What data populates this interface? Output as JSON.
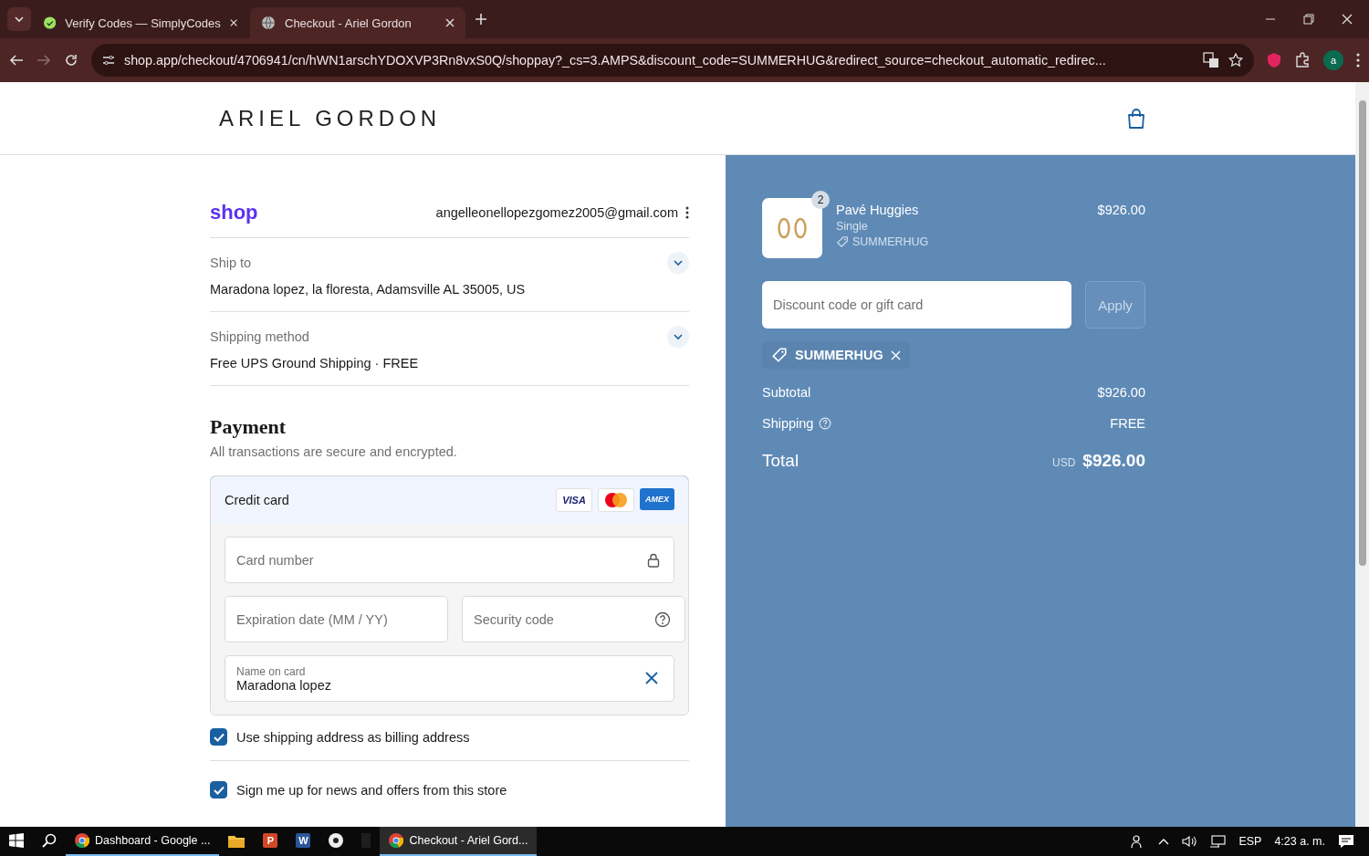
{
  "browser": {
    "tabs": [
      {
        "title": "Verify Codes — SimplyCodes",
        "selected": false
      },
      {
        "title": "Checkout - Ariel Gordon",
        "selected": true
      }
    ],
    "url": "shop.app/checkout/4706941/cn/hWN1arschYDOXVP3Rn8vxS0Q/shoppay?_cs=3.AMPS&discount_code=SUMMERHUG&redirect_source=checkout_automatic_redirec...",
    "profile": "a"
  },
  "header": {
    "logo": "ARIEL GORDON"
  },
  "account": {
    "shop_logo": "shop",
    "email": "angelleonellopezgomez2005@gmail.com"
  },
  "sections": [
    {
      "label": "Ship to",
      "value": "Maradona lopez, la floresta, Adamsville AL 35005, US"
    },
    {
      "label": "Shipping method",
      "value": "Free UPS Ground Shipping · FREE"
    }
  ],
  "payment": {
    "title": "Payment",
    "subtitle": "All transactions are secure and encrypted.",
    "method": "Credit card",
    "brands": [
      "VISA",
      "AMEX"
    ],
    "card_number": {
      "placeholder": "Card number"
    },
    "expiration": {
      "placeholder": "Expiration date (MM / YY)"
    },
    "security_code": {
      "placeholder": "Security code"
    },
    "name_on_card": {
      "label": "Name on card",
      "value": "Maradona lopez"
    }
  },
  "options": [
    {
      "label": "Use shipping address as billing address",
      "checked": true
    },
    {
      "label": "Sign me up for news and offers from this store",
      "checked": true
    }
  ],
  "summary": {
    "item": {
      "name": "Pavé Huggies",
      "variant": "Single",
      "discount": "SUMMERHUG",
      "price": "$926.00",
      "quantity": "2"
    },
    "discount_field": {
      "placeholder": "Discount code or gift card"
    },
    "apply": "Apply",
    "applied_code": "SUMMERHUG",
    "subtotal_label": "Subtotal",
    "subtotal": "$926.00",
    "shipping_label": "Shipping",
    "shipping": "FREE",
    "total_label": "Total",
    "currency": "USD",
    "total": "$926.00"
  },
  "taskbar": {
    "apps": [
      {
        "kind": "chrome",
        "label": "Dashboard - Google ...",
        "selected": false
      },
      {
        "kind": "folder",
        "selected": false
      },
      {
        "kind": "powerpoint",
        "letter": "P",
        "selected": false
      },
      {
        "kind": "word",
        "letter": "W",
        "selected": false
      },
      {
        "kind": "dot",
        "selected": false
      },
      {
        "kind": "blank",
        "selected": false
      },
      {
        "kind": "chrome",
        "label": "Checkout - Ariel Gord...",
        "selected": true
      }
    ],
    "language": "ESP",
    "time": "4:23 a. m."
  }
}
